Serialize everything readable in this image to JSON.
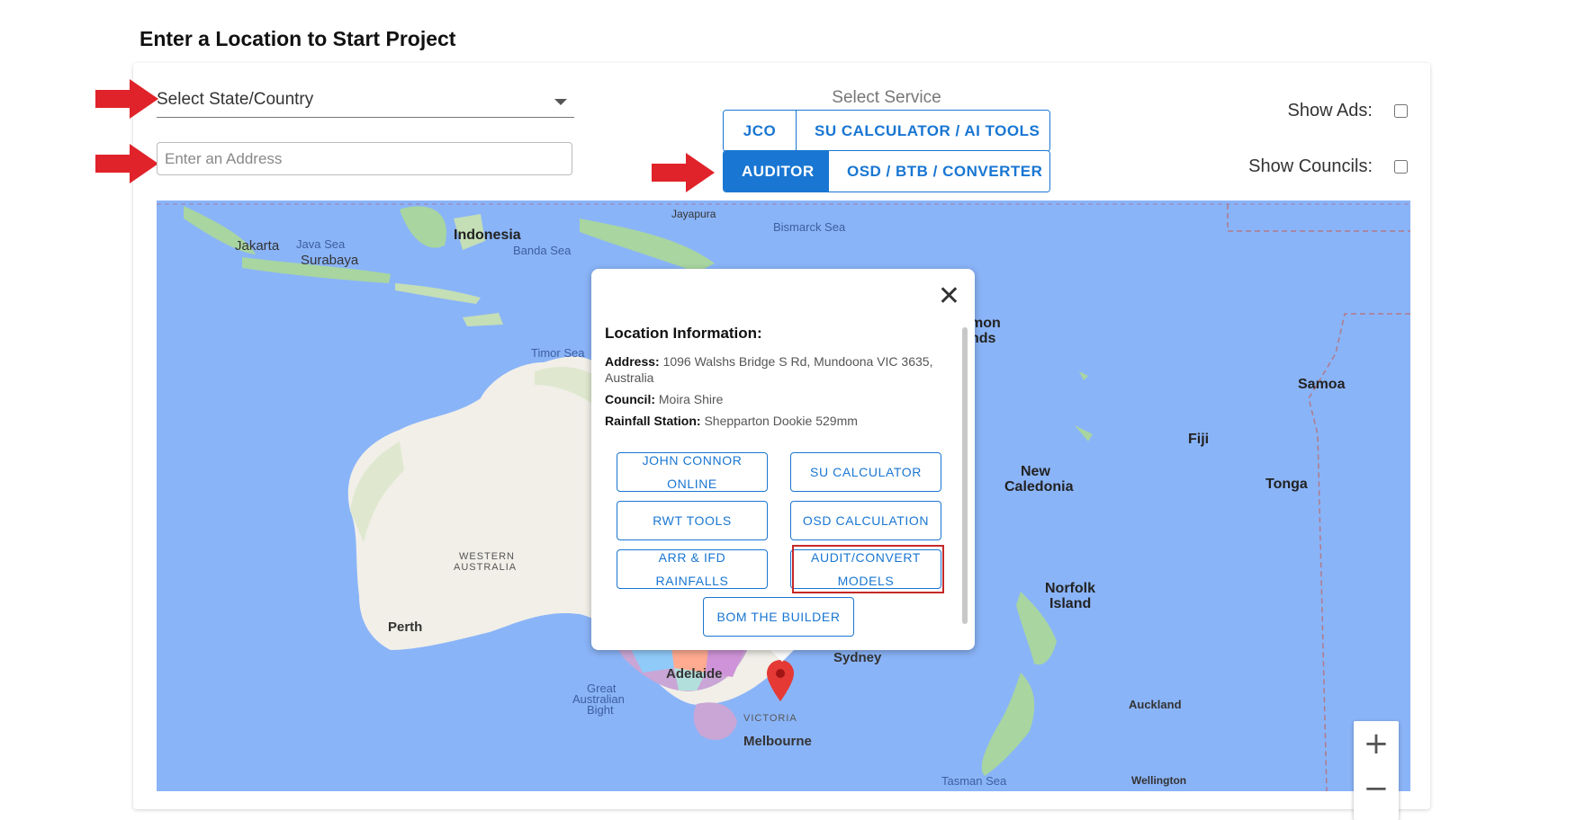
{
  "page": {
    "title": "Enter a Location to Start Project"
  },
  "location": {
    "state_select_value": "Select State/Country",
    "address_placeholder": "Enter an Address"
  },
  "service": {
    "label": "Select Service",
    "buttons_row1": [
      "JCO",
      "SU CALCULATOR / AI TOOLS"
    ],
    "buttons_row2": [
      "AUDITOR",
      "OSD / BTB / CONVERTER"
    ],
    "active": "AUDITOR"
  },
  "toggles": {
    "show_ads_label": "Show Ads:",
    "show_ads_checked": false,
    "show_councils_label": "Show Councils:",
    "show_councils_checked": false
  },
  "map": {
    "labels": [
      "Jakarta",
      "Java Sea",
      "Surabaya",
      "Indonesia",
      "Banda Sea",
      "Jayapura",
      "Bismarck Sea",
      "Timor Sea",
      "mon",
      "nds",
      "Samoa",
      "Fiji",
      "Tonga",
      "New",
      "Caledonia",
      "WESTERN",
      "AUSTRALIA",
      "Norfolk",
      "Island",
      "Perth",
      "Great",
      "Australian",
      "Bight",
      "Adelaide",
      "Sydney",
      "Auckland",
      "Melbourne",
      "Tasman Sea",
      "Wellington",
      "VICTORIA"
    ],
    "zoom_in": "+",
    "zoom_out": "−"
  },
  "popup": {
    "heading": "Location Information:",
    "address_label": "Address:",
    "address_value": "1096 Walshs Bridge S Rd, Mundoona VIC 3635, Australia",
    "council_label": "Council:",
    "council_value": "Moira Shire",
    "rainfall_label": "Rainfall Station:",
    "rainfall_value": "Shepparton Dookie 529mm",
    "buttons": [
      "JOHN CONNOR ONLINE",
      "SU CALCULATOR",
      "RWT TOOLS",
      "OSD CALCULATION",
      "ARR & IFD RAINFALLS",
      "AUDIT/CONVERT MODELS",
      "BOM THE BUILDER"
    ],
    "close_symbol": "✕"
  },
  "colors": {
    "accent": "#1976d2",
    "arrow": "#e0232a",
    "highlight": "#c62828",
    "ocean": "#8ab4f8",
    "land": "#f1efe8"
  }
}
